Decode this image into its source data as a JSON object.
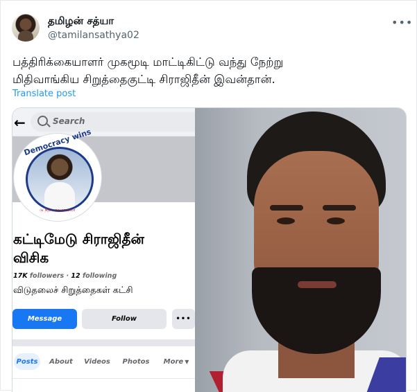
{
  "post": {
    "author_name": "தமிழன் சத்யா",
    "handle": "@tamilansathya02",
    "more_icon": "more-horizontal-icon",
    "text_line1": "பத்திரிக்கையாளர் முகமூடி மாட்டிகிட்டு வந்து நேற்று",
    "text_line2": "மிதிவாங்கிய சிறுத்தைகுட்டி சிராஜிதீன் இவன்தான்.",
    "translate_label": "Translate post"
  },
  "fb_screenshot": {
    "search_placeholder": "Search",
    "cover_badge_text": "Democracy wins",
    "profile_caption": "டு நீதி பாதுகாவலர்",
    "page_name_line1": "கட்டிமேடு சிராஜிதீன்",
    "page_name_line2": "விசிக",
    "followers": "17K",
    "followers_label": "followers",
    "following": "12",
    "following_label": "following",
    "bio": "விடுதலைச் சிறுத்தைகள் கட்சி",
    "message_label": "Message",
    "follow_label": "Follow",
    "more_label": "•••",
    "tabs": [
      "Posts",
      "About",
      "Videos",
      "Photos",
      "More"
    ],
    "accent_color": "#1877f2"
  }
}
